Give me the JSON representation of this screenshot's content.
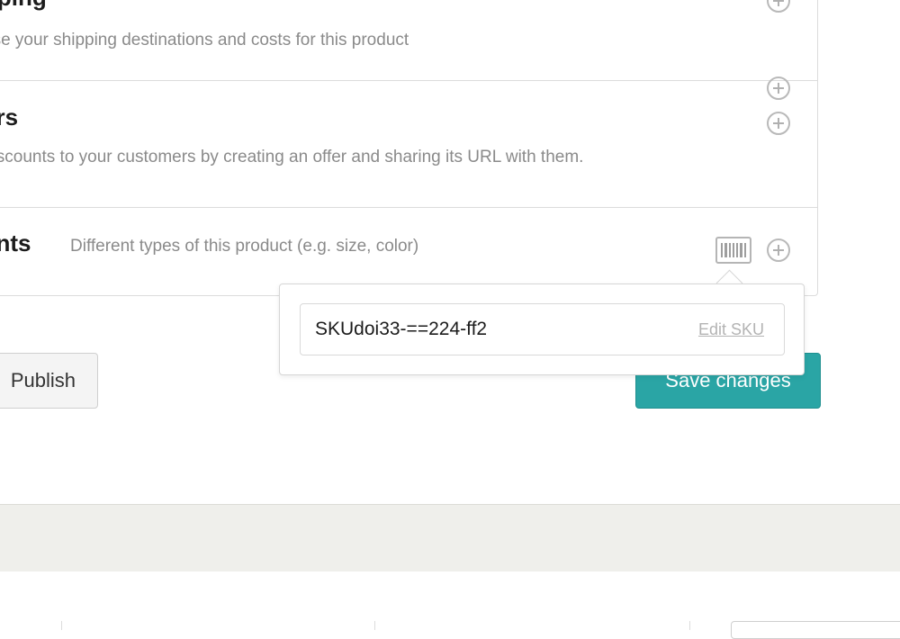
{
  "sections": {
    "shipping": {
      "title": "pping",
      "description": "ose your shipping destinations and costs for this product"
    },
    "offers": {
      "title": "ers",
      "description": "discounts to your customers by creating an offer and sharing its URL with them."
    },
    "variants": {
      "title": "ants",
      "description": "Different types of this product (e.g. size, color)"
    }
  },
  "sku_popover": {
    "sku_value": "SKUdoi33-==224-ff2",
    "edit_label": "Edit SKU"
  },
  "actions": {
    "publish_label": "Publish",
    "save_label": "Save changes"
  },
  "colors": {
    "accent": "#2aa5a5",
    "muted_text": "#8a8a8a",
    "footer_band": "#efefeb"
  },
  "icons": [
    "plus-circle-icon",
    "barcode-icon"
  ]
}
